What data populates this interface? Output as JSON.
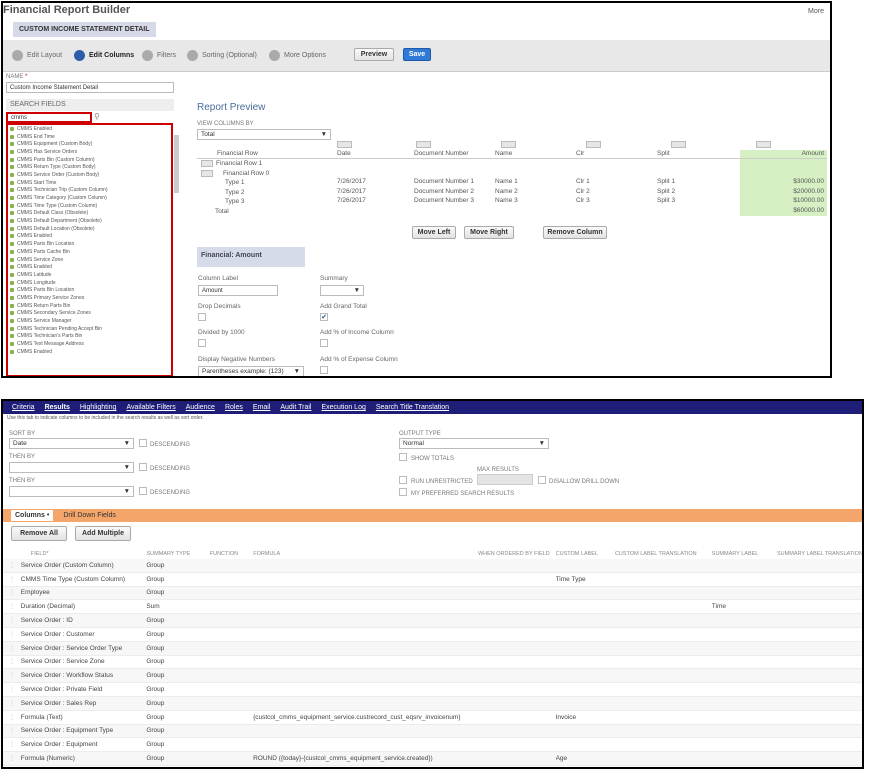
{
  "p1": {
    "title": "Financial Report Builder",
    "more": "More",
    "report_title": "CUSTOM INCOME STATEMENT DETAIL",
    "steps": [
      {
        "label": "Edit Layout",
        "active": false
      },
      {
        "label": "Edit Columns",
        "active": true
      },
      {
        "label": "Filters",
        "active": false
      },
      {
        "label": "Sorting (Optional)",
        "active": false
      },
      {
        "label": "More Options",
        "active": false
      }
    ],
    "preview_btn": "Preview",
    "save_btn": "Save",
    "name_label": "NAME",
    "name_required": "*",
    "name_value": "Custom Income Statement Detail",
    "search_label": "SEARCH FIELDS",
    "search_value": "cmms",
    "fields": [
      "CMMS Enabled",
      "CMMS End Time",
      "CMMS Equipment (Custom Body)",
      "CMMS Has Service Orders",
      "CMMS Parts Bin (Custom Column)",
      "CMMS Return Type (Custom Body)",
      "CMMS Service Order (Custom Body)",
      "CMMS Start Time",
      "CMMS Technician Trip (Custom Column)",
      "CMMS Time Category (Custom Column)",
      "CMMS Time Type (Custom Column)",
      "CMMS Default Class (Obsolete)",
      "CMMS Default Department (Obsolete)",
      "CMMS Default Location (Obsolete)",
      "CMMS Enabled",
      "CMMS Parts Bin Location",
      "CMMS Parts Cache Bin",
      "CMMS Service Zone",
      "CMMS Enabled",
      "CMMS Latitude",
      "CMMS Longitude",
      "CMMS Parts Bin Location",
      "CMMS Primary Service Zones",
      "CMMS Return Parts Bin",
      "CMMS Secondary Service Zones",
      "CMMS Service Manager",
      "CMMS Technician Pending Accept Bin",
      "CMMS Technician's Parts Bin",
      "CMMS Text Message Address",
      "CMMS Enabled"
    ],
    "preview_title": "Report Preview",
    "view_columns_label": "VIEW COLUMNS BY",
    "view_columns_value": "Total",
    "grid_headers": [
      "Financial Row",
      "Date",
      "Document Number",
      "Name",
      "Clr",
      "Split",
      "Amount"
    ],
    "grid_rows": [
      {
        "label": "Financial Row 1",
        "indent": 0,
        "vals": [
          "",
          "",
          "",
          "",
          "",
          ""
        ]
      },
      {
        "label": "Financial Row 0",
        "indent": 1,
        "vals": [
          "",
          "",
          "",
          "",
          "",
          ""
        ]
      },
      {
        "label": "Type 1",
        "indent": 2,
        "vals": [
          "7/26/2017",
          "Document Number 1",
          "Name 1",
          "Clr 1",
          "Split 1",
          "$30000.00"
        ]
      },
      {
        "label": "Type 2",
        "indent": 2,
        "vals": [
          "7/26/2017",
          "Document Number 2",
          "Name 2",
          "Clr 2",
          "Split 2",
          "$20000.00"
        ]
      },
      {
        "label": "Type 3",
        "indent": 2,
        "vals": [
          "7/26/2017",
          "Document Number 3",
          "Name 3",
          "Clr 3",
          "Split 3",
          "$10000.00"
        ]
      },
      {
        "label": "Total",
        "indent": 1,
        "vals": [
          "",
          "",
          "",
          "",
          "",
          "$60000.00"
        ]
      }
    ],
    "move_left": "Move Left",
    "move_right": "Move Right",
    "remove_column": "Remove Column",
    "section_title": "Financial: Amount",
    "column_label_label": "Column Label",
    "column_label_value": "Amount",
    "summary_label": "Summary",
    "drop_decimals": "Drop Decimals",
    "add_grand_total": "Add Grand Total",
    "divided_by_1000": "Divided by 1000",
    "add_pct_income": "Add % of Income Column",
    "display_negative": "Display Negative Numbers",
    "negative_value": "Parentheses  example: (123)",
    "add_pct_expense": "Add % of Expense Column"
  },
  "p2": {
    "tabs": [
      {
        "label": "Criteria",
        "active": false
      },
      {
        "label": "Results",
        "active": true
      },
      {
        "label": "Highlighting",
        "active": false
      },
      {
        "label": "Available Filters",
        "active": false
      },
      {
        "label": "Audience",
        "active": false
      },
      {
        "label": "Roles",
        "active": false
      },
      {
        "label": "Email",
        "active": false
      },
      {
        "label": "Audit Trail",
        "active": false
      },
      {
        "label": "Execution Log",
        "active": false
      },
      {
        "label": "Search Title Translation",
        "active": false
      }
    ],
    "hint": "Use this tab to indicate columns to be included in the search results as well as sort order.",
    "sort_by": "SORT BY",
    "sort_value": "Date",
    "then_by": "THEN BY",
    "descending": "DESCENDING",
    "output_type": "OUTPUT TYPE",
    "output_value": "Normal",
    "show_totals": "SHOW TOTALS",
    "max_results": "MAX RESULTS",
    "run_unrestricted": "RUN UNRESTRICTED",
    "disallow_drill_down": "DISALLOW DRILL DOWN",
    "my_preferred": "MY PREFERRED SEARCH RESULTS",
    "subtab_columns": "Columns",
    "subtab_columns_mark": "•",
    "subtab_drill": "Drill Down Fields",
    "remove_all": "Remove All",
    "add_multiple": "Add Multiple",
    "col_headers": [
      "FIELD*",
      "SUMMARY TYPE",
      "FUNCTION",
      "FORMULA",
      "WHEN ORDERED BY FIELD",
      "CUSTOM LABEL",
      "CUSTOM LABEL TRANSLATION",
      "SUMMARY LABEL",
      "SUMMARY LABEL TRANSLATION"
    ],
    "rows": [
      [
        "Service Order (Custom Column)",
        "Group",
        "",
        "",
        "",
        "",
        "",
        "",
        ""
      ],
      [
        "CMMS Time Type (Custom Column)",
        "Group",
        "",
        "",
        "",
        "Time Type",
        "",
        "",
        ""
      ],
      [
        "Employee",
        "Group",
        "",
        "",
        "",
        "",
        "",
        "",
        ""
      ],
      [
        "Duration (Decimal)",
        "Sum",
        "",
        "",
        "",
        "",
        "",
        "Time",
        ""
      ],
      [
        "Service Order : ID",
        "Group",
        "",
        "",
        "",
        "",
        "",
        "",
        ""
      ],
      [
        "Service Order : Customer",
        "Group",
        "",
        "",
        "",
        "",
        "",
        "",
        ""
      ],
      [
        "Service Order : Service Order Type",
        "Group",
        "",
        "",
        "",
        "",
        "",
        "",
        ""
      ],
      [
        "Service Order : Service Zone",
        "Group",
        "",
        "",
        "",
        "",
        "",
        "",
        ""
      ],
      [
        "Service Order : Workflow Status",
        "Group",
        "",
        "",
        "",
        "",
        "",
        "",
        ""
      ],
      [
        "Service Order : Private Field",
        "Group",
        "",
        "",
        "",
        "",
        "",
        "",
        ""
      ],
      [
        "Service Order : Sales Rep",
        "Group",
        "",
        "",
        "",
        "",
        "",
        "",
        ""
      ],
      [
        "Formula (Text)",
        "Group",
        "",
        "{custcol_cmms_equipment_service.custrecord_cust_eqsrv_invoicenum}",
        "",
        "Invoice",
        "",
        "",
        ""
      ],
      [
        "Service Order : Equipment Type",
        "Group",
        "",
        "",
        "",
        "",
        "",
        "",
        ""
      ],
      [
        "Service Order : Equipment",
        "Group",
        "",
        "",
        "",
        "",
        "",
        "",
        ""
      ],
      [
        "Formula (Numeric)",
        "Group",
        "",
        "ROUND ({today}-{custcol_cmms_equipment_service.created})",
        "",
        "Age",
        "",
        "",
        ""
      ]
    ]
  }
}
